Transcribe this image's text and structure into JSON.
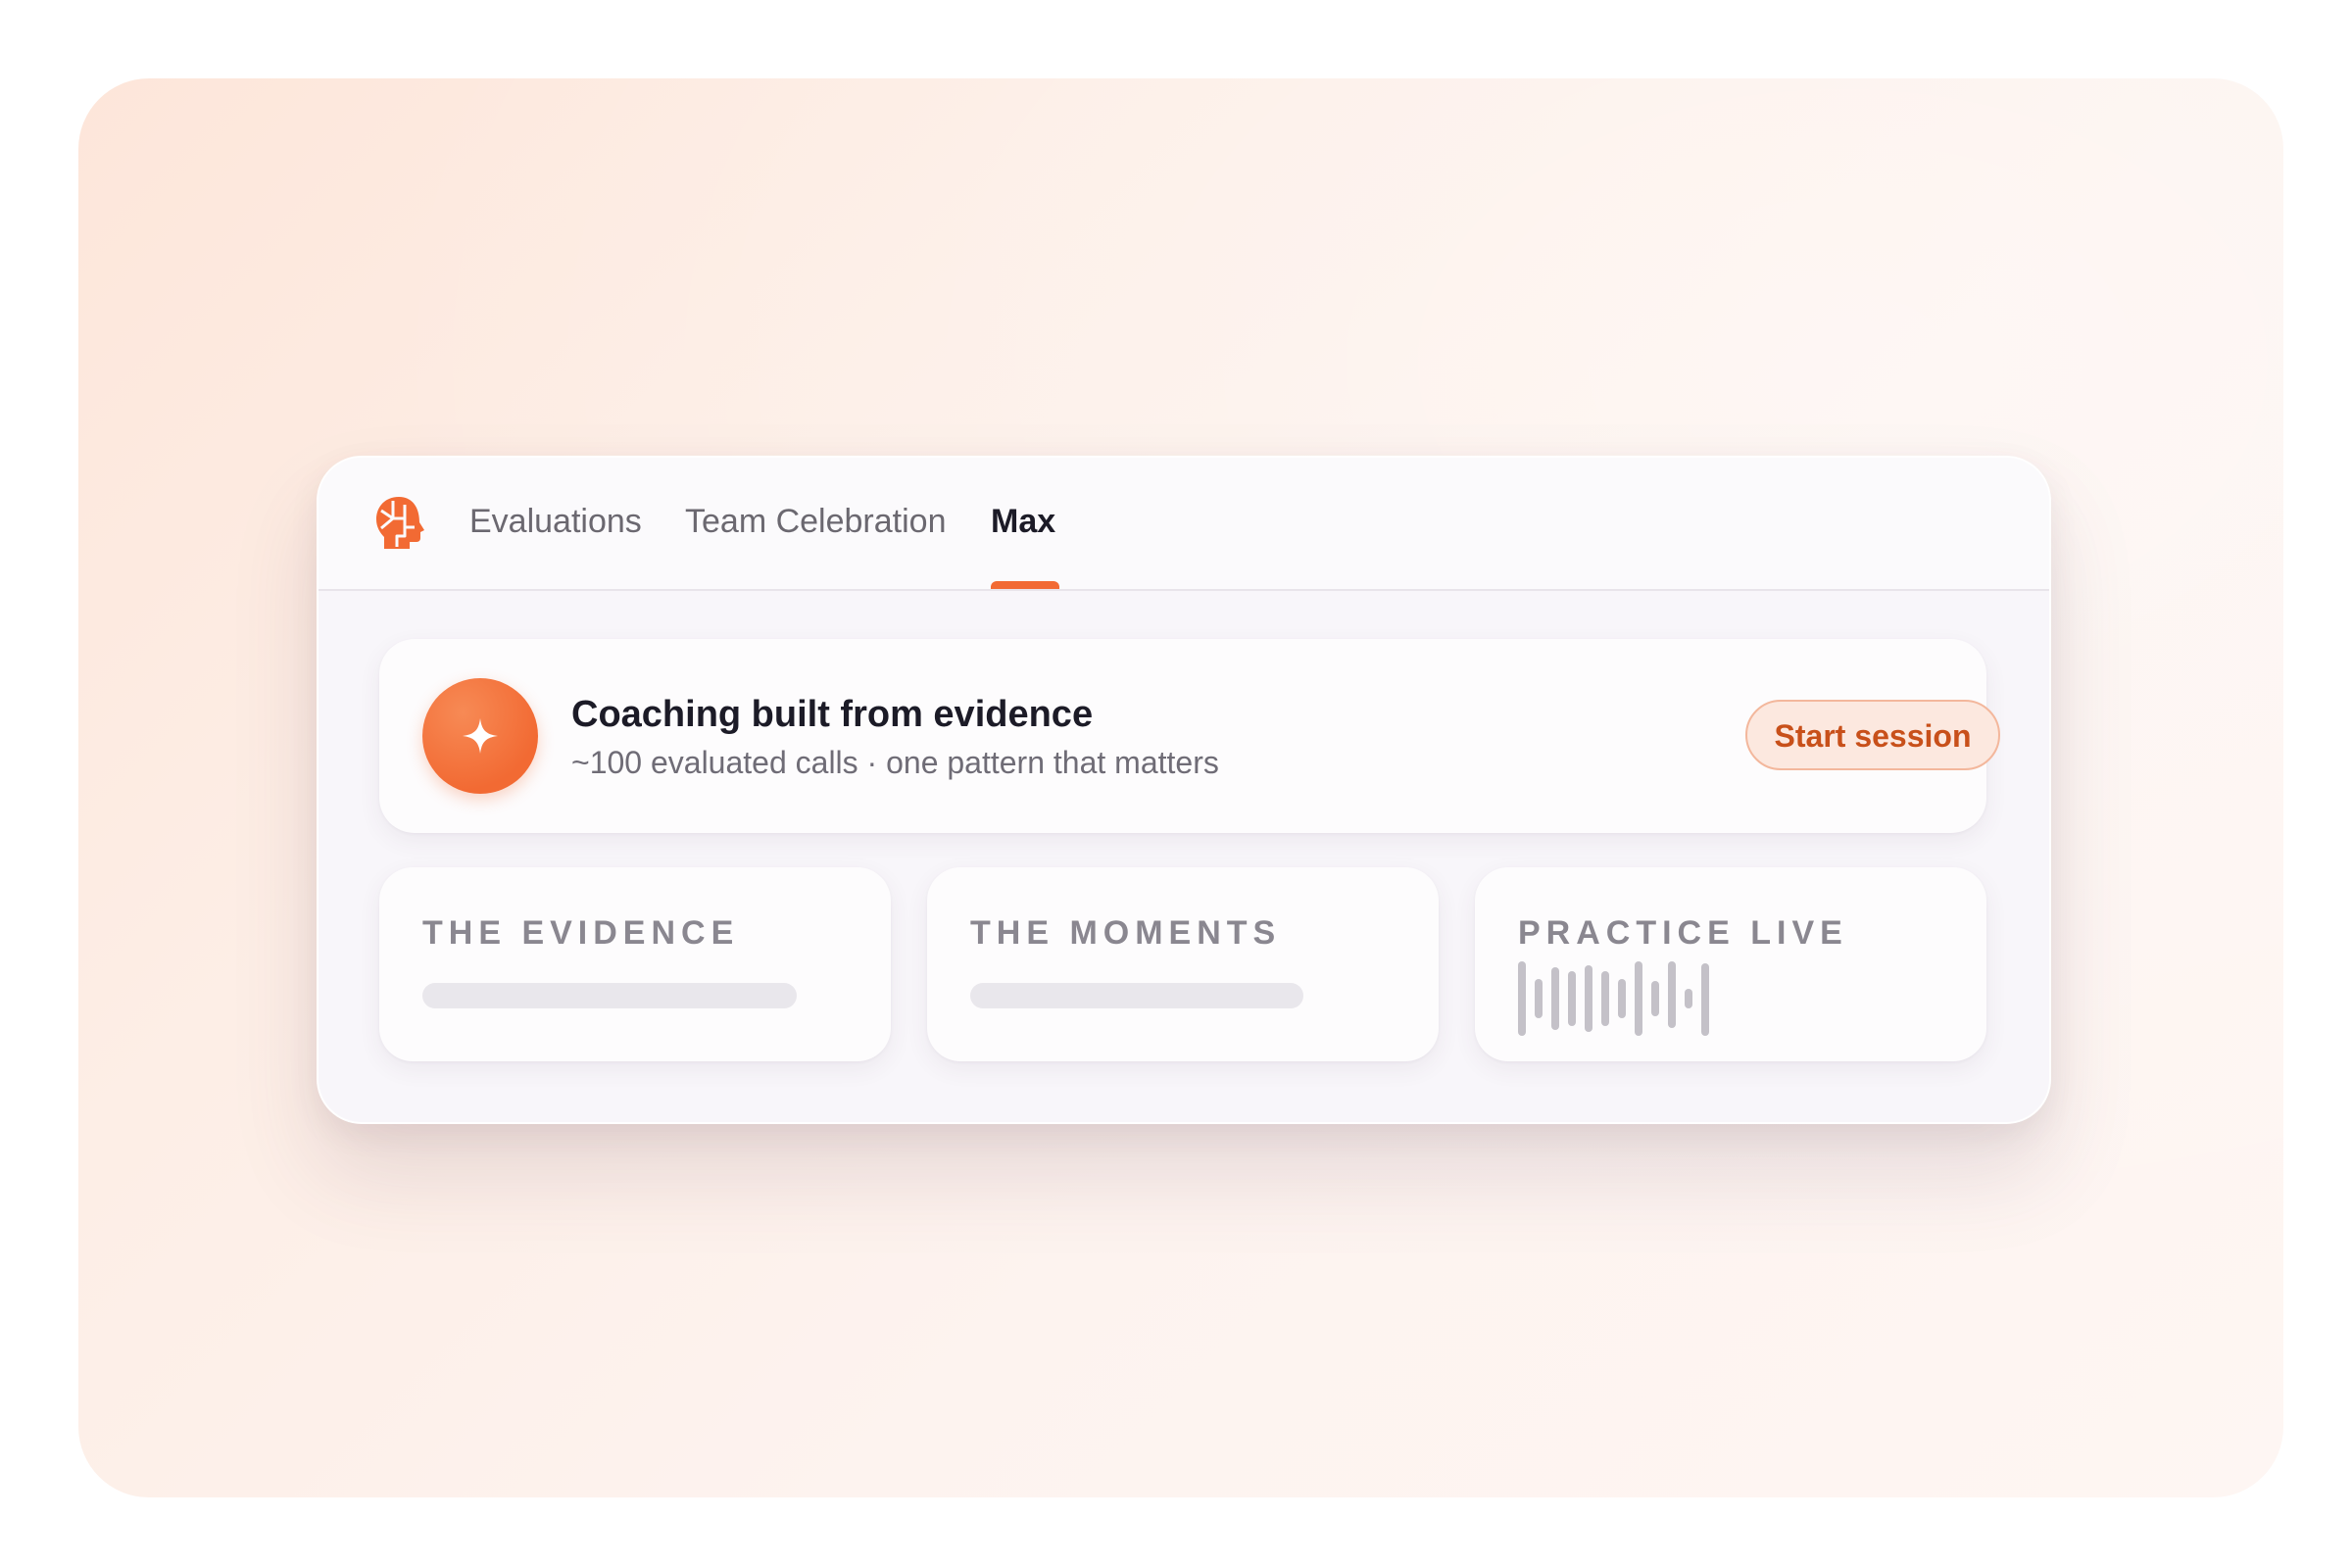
{
  "header": {
    "logo_icon": "brain-head-logo-icon",
    "tabs": [
      {
        "label": "Evaluations",
        "active": false
      },
      {
        "label": "Team Celebration",
        "active": false
      },
      {
        "label": "Max",
        "active": true
      }
    ]
  },
  "hero": {
    "icon": "sparkle-icon",
    "title": "Coaching built from evidence",
    "subtitle": "~100 evaluated calls · one pattern that matters",
    "button_label": "Start session"
  },
  "cards": [
    {
      "title": "THE EVIDENCE"
    },
    {
      "title": "THE MOMENTS"
    },
    {
      "title": "PRACTICE LIVE",
      "icon": "audio-waveform-icon"
    }
  ],
  "colors": {
    "accent": "#f26a33",
    "button_text": "#c8501a",
    "button_bg": "#fce8df",
    "text_primary": "#1c1b27",
    "text_secondary": "#6f6c76"
  }
}
